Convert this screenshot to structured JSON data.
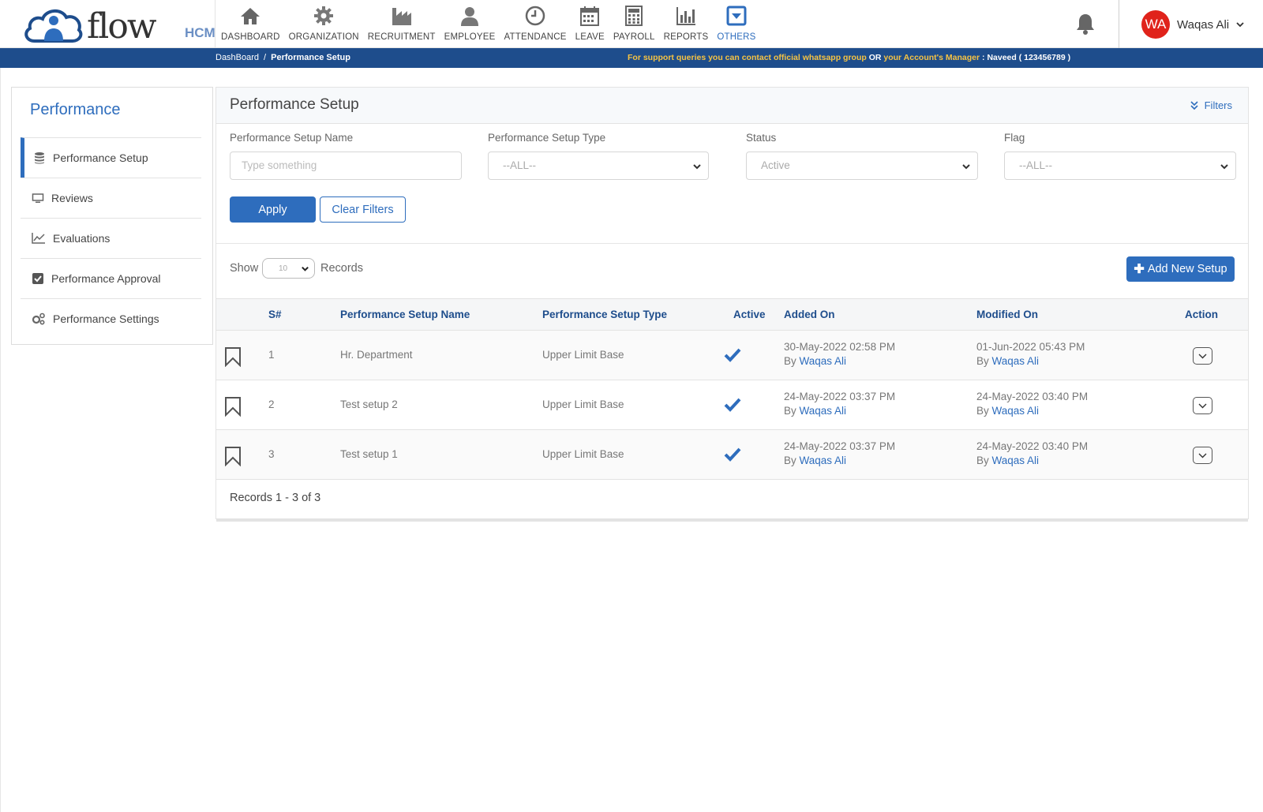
{
  "brand": {
    "logo_text": "flow",
    "logo_suffix": "HCM"
  },
  "nav": [
    {
      "label": "DASHBOARD",
      "icon": "home-icon"
    },
    {
      "label": "ORGANIZATION",
      "icon": "gear-icon"
    },
    {
      "label": "RECRUITMENT",
      "icon": "factory-icon"
    },
    {
      "label": "EMPLOYEE",
      "icon": "person-icon"
    },
    {
      "label": "ATTENDANCE",
      "icon": "clock-icon"
    },
    {
      "label": "LEAVE",
      "icon": "calendar-icon"
    },
    {
      "label": "PAYROLL",
      "icon": "calculator-icon"
    },
    {
      "label": "REPORTS",
      "icon": "bar-chart-icon"
    },
    {
      "label": "OTHERS",
      "icon": "dropdown-box-icon",
      "active": true
    }
  ],
  "user": {
    "initials": "WA",
    "name": "Waqas Ali"
  },
  "breadcrumb": {
    "root": "DashBoard",
    "separator": "/",
    "current": "Performance Setup"
  },
  "support": {
    "part1": "For support queries you can contact official whatsapp group",
    "or": "OR",
    "part2": "your Account's Manager",
    "contact": ": Naveed ( 123456789 )"
  },
  "sidebar": {
    "title": "Performance",
    "items": [
      {
        "label": "Performance Setup",
        "icon": "database-icon",
        "active": true
      },
      {
        "label": "Reviews",
        "icon": "monitor-icon"
      },
      {
        "label": "Evaluations",
        "icon": "line-chart-icon"
      },
      {
        "label": "Performance Approval",
        "icon": "checkbox-icon"
      },
      {
        "label": "Performance Settings",
        "icon": "gears-icon"
      }
    ]
  },
  "main": {
    "title": "Performance Setup",
    "filters_link": "Filters",
    "filters": {
      "name_label": "Performance Setup Name",
      "name_placeholder": "Type something",
      "type_label": "Performance Setup Type",
      "type_value": "--ALL--",
      "status_label": "Status",
      "status_value": "Active",
      "flag_label": "Flag",
      "flag_value": "--ALL--"
    },
    "apply_label": "Apply",
    "clear_label": "Clear Filters",
    "show_label": "Show",
    "show_value": "10",
    "records_label": "Records",
    "add_label": "Add New Setup",
    "columns": [
      "S#",
      "Performance Setup Name",
      "Performance Setup Type",
      "Active",
      "Added On",
      "Modified On",
      "Action"
    ],
    "rows": [
      {
        "sno": "1",
        "name": "Hr. Department",
        "type": "Upper Limit Base",
        "active": true,
        "added_date": "30-May-2022 02:58 PM",
        "added_by": "Waqas Ali",
        "modified_date": "01-Jun-2022 05:43 PM",
        "modified_by": "Waqas Ali"
      },
      {
        "sno": "2",
        "name": "Test setup 2",
        "type": "Upper Limit Base",
        "active": true,
        "added_date": "24-May-2022 03:37 PM",
        "added_by": "Waqas Ali",
        "modified_date": "24-May-2022 03:40 PM",
        "modified_by": "Waqas Ali"
      },
      {
        "sno": "3",
        "name": "Test setup 1",
        "type": "Upper Limit Base",
        "active": true,
        "added_date": "24-May-2022 03:37 PM",
        "added_by": "Waqas Ali",
        "modified_date": "24-May-2022 03:40 PM",
        "modified_by": "Waqas Ali"
      }
    ],
    "by_label": "By",
    "records_info": "Records 1 - 3 of 3"
  },
  "colors": {
    "primary": "#2e6dbd",
    "strip": "#1e4d8c",
    "support_text": "#f6c343",
    "avatar": "#e0231b"
  }
}
